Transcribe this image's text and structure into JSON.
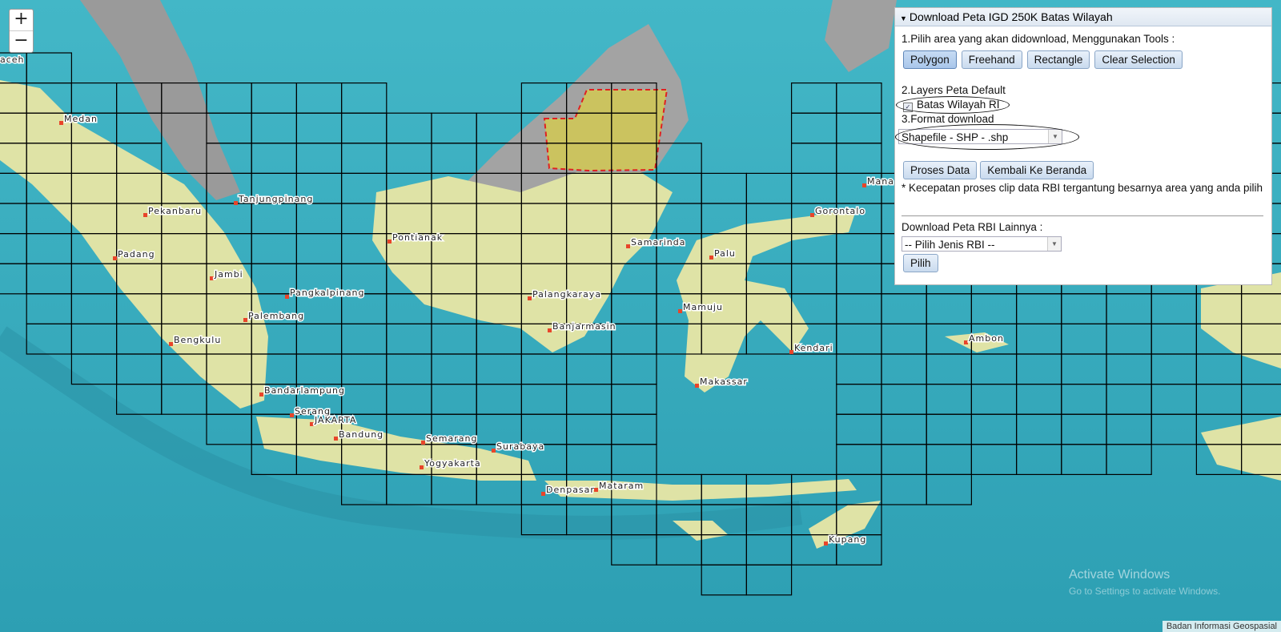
{
  "panel": {
    "title": "Download Peta IGD 250K Batas Wilayah",
    "step1": "1.Pilih area yang akan didownload, Menggunakan Tools :",
    "tools": [
      "Polygon",
      "Freehand",
      "Rectangle",
      "Clear Selection"
    ],
    "step2": "2.Layers Peta Default",
    "layer_label": "Batas Wilayah RI",
    "step3": "3.Format download",
    "format_value": "Shapefile - SHP - .shp",
    "process_button": "Proses Data",
    "back_button": "Kembali Ke Beranda",
    "note": "* Kecepatan proses clip data RBI tergantung besarnya area yang anda pilih",
    "other_label": "Download Peta RBI Lainnya :",
    "rbi_select": "-- Pilih Jenis RBI --",
    "pick_button": "Pilih"
  },
  "zoom": {
    "in": "+",
    "out": "−"
  },
  "attribution": "Badan Informasi Geospasial",
  "watermark": {
    "line1": "Activate Windows",
    "line2": "Go to Settings to activate Windows."
  },
  "cities": [
    "aceh",
    "Medan",
    "Tanjungpinang",
    "Pekanbaru",
    "Padang",
    "Jambi",
    "Pangkalpinang",
    "Palembang",
    "Bengkulu",
    "Bandarlampung",
    "Serang",
    "JAKARTA",
    "Bandung",
    "Semarang",
    "Surabaya",
    "Yogyakarta",
    "Denpasar",
    "Mataram",
    "Kupang",
    "Pontianak",
    "Palangkaraya",
    "Banjarmasin",
    "Samarinda",
    "Palu",
    "Mamuju",
    "Makassar",
    "Kendari",
    "Gorontalo",
    "Mana",
    "Ambon"
  ],
  "colors": {
    "sea": "#3fb0c2",
    "land": "#dfe3a6",
    "grid": "#000000",
    "selection": "#e0d43a",
    "roads": "#e8452a"
  }
}
